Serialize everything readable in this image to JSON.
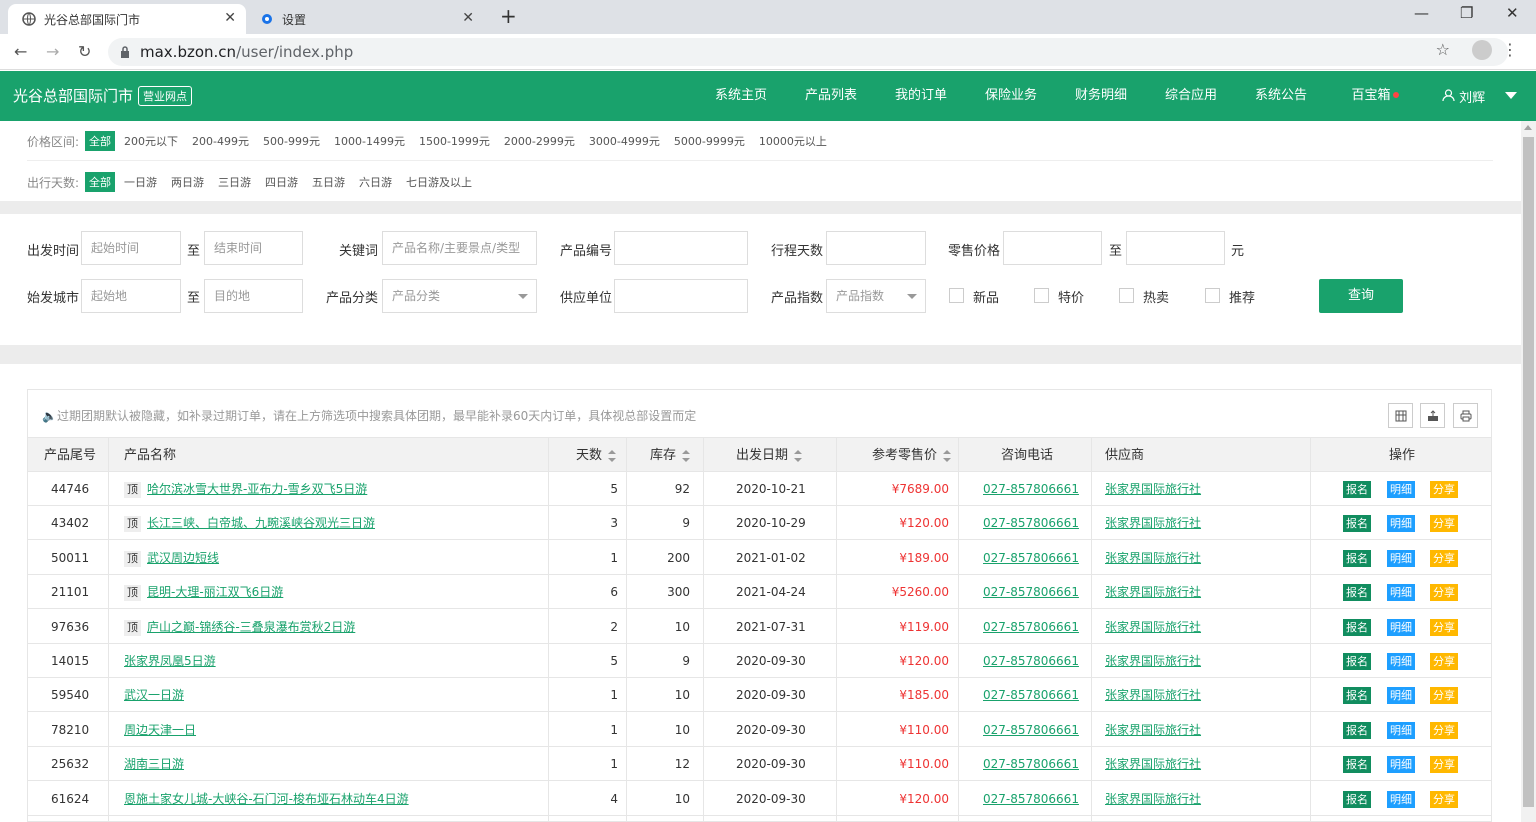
{
  "browser": {
    "tabs": [
      {
        "title": "光谷总部国际门市",
        "icon": "globe-icon"
      },
      {
        "title": "设置",
        "icon": "gear-icon"
      }
    ],
    "url_domain": "max.bzon.cn",
    "url_path": "/user/index.php"
  },
  "header": {
    "brand": "光谷总部国际门市",
    "brand_tag": "营业网点",
    "nav": [
      "系统主页",
      "产品列表",
      "我的订单",
      "保险业务",
      "财务明细",
      "综合应用",
      "系统公告",
      "百宝箱"
    ],
    "user": "刘辉",
    "accent": "#19a26c"
  },
  "filters": {
    "price_label": "价格区间:",
    "all": "全部",
    "price_options": [
      "200元以下",
      "200-499元",
      "500-999元",
      "1000-1499元",
      "1500-1999元",
      "2000-2999元",
      "3000-4999元",
      "5000-9999元",
      "10000元以上"
    ],
    "days_label": "出行天数:",
    "days_options": [
      "一日游",
      "两日游",
      "三日游",
      "四日游",
      "五日游",
      "六日游",
      "七日游及以上"
    ]
  },
  "search": {
    "depart_time": "出发时间",
    "start_time_ph": "起始时间",
    "to": "至",
    "end_time_ph": "结束时间",
    "keyword": "关键词",
    "keyword_ph": "产品名称/主要景点/类型",
    "product_no": "产品编号",
    "trip_days": "行程天数",
    "retail_price": "零售价格",
    "yuan": "元",
    "origin_city": "始发城市",
    "origin_ph": "起始地",
    "dest_ph": "目的地",
    "category": "产品分类",
    "category_ph": "产品分类",
    "supplier": "供应单位",
    "index": "产品指数",
    "index_ph": "产品指数",
    "checkboxes": [
      "新品",
      "特价",
      "热卖",
      "推荐"
    ],
    "query_button": "查询"
  },
  "table": {
    "notice": "过期团期默认被隐藏，如补录过期订单，请在上方筛选项中搜索具体团期，最早能补录60天内订单，具体视总部设置而定",
    "columns": [
      "产品尾号",
      "产品名称",
      "天数",
      "库存",
      "出发日期",
      "参考零售价",
      "咨询电话",
      "供应商",
      "操作"
    ],
    "top_badge": "顶",
    "actions": [
      "报名",
      "明细",
      "分享"
    ],
    "rows": [
      {
        "id": "44746",
        "top": true,
        "name": "哈尔滨冰雪大世界-亚布力-雪乡双飞5日游",
        "days": "5",
        "stock": "92",
        "date": "2020-10-21",
        "price": "¥7689.00",
        "phone": "027-857806661",
        "supplier": "张家界国际旅行社"
      },
      {
        "id": "43402",
        "top": true,
        "name": "长江三峡、白帝城、九畹溪峡谷观光三日游",
        "days": "3",
        "stock": "9",
        "date": "2020-10-29",
        "price": "¥120.00",
        "phone": "027-857806661",
        "supplier": "张家界国际旅行社"
      },
      {
        "id": "50011",
        "top": true,
        "name": "武汉周边短线",
        "days": "1",
        "stock": "200",
        "date": "2021-01-02",
        "price": "¥189.00",
        "phone": "027-857806661",
        "supplier": "张家界国际旅行社"
      },
      {
        "id": "21101",
        "top": true,
        "name": "昆明-大理-丽江双飞6日游",
        "days": "6",
        "stock": "300",
        "date": "2021-04-24",
        "price": "¥5260.00",
        "phone": "027-857806661",
        "supplier": "张家界国际旅行社"
      },
      {
        "id": "97636",
        "top": true,
        "name": "庐山之巅-锦绣谷-三叠泉瀑布赏秋2日游",
        "days": "2",
        "stock": "10",
        "date": "2021-07-31",
        "price": "¥119.00",
        "phone": "027-857806661",
        "supplier": "张家界国际旅行社"
      },
      {
        "id": "14015",
        "top": false,
        "name": "张家界凤凰5日游",
        "days": "5",
        "stock": "9",
        "date": "2020-09-30",
        "price": "¥120.00",
        "phone": "027-857806661",
        "supplier": "张家界国际旅行社"
      },
      {
        "id": "59540",
        "top": false,
        "name": "武汉一日游",
        "days": "1",
        "stock": "10",
        "date": "2020-09-30",
        "price": "¥185.00",
        "phone": "027-857806661",
        "supplier": "张家界国际旅行社"
      },
      {
        "id": "78210",
        "top": false,
        "name": "周边天津一日",
        "days": "1",
        "stock": "10",
        "date": "2020-09-30",
        "price": "¥110.00",
        "phone": "027-857806661",
        "supplier": "张家界国际旅行社"
      },
      {
        "id": "25632",
        "top": false,
        "name": "湖南三日游",
        "days": "1",
        "stock": "12",
        "date": "2020-09-30",
        "price": "¥110.00",
        "phone": "027-857806661",
        "supplier": "张家界国际旅行社"
      },
      {
        "id": "61624",
        "top": false,
        "name": "恩施土家女儿城-大峡谷-石门河-梭布垭石林动车4日游",
        "days": "4",
        "stock": "10",
        "date": "2020-09-30",
        "price": "¥120.00",
        "phone": "027-857806661",
        "supplier": "张家界国际旅行社"
      }
    ]
  }
}
